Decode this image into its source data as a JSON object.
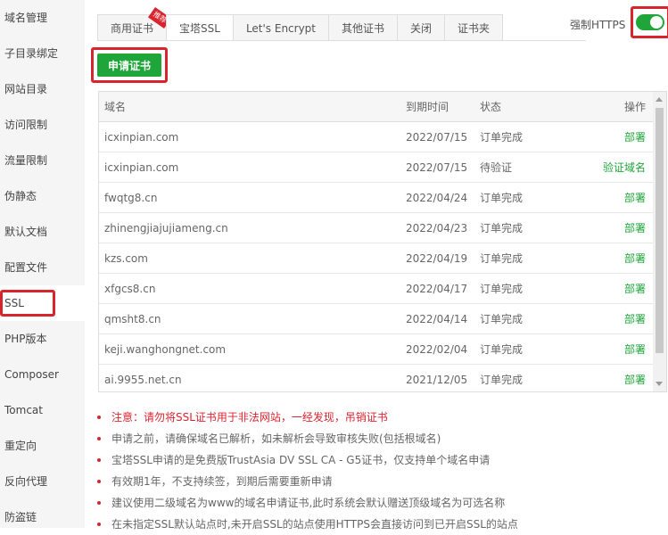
{
  "sidebar": {
    "items": [
      {
        "label": "域名管理"
      },
      {
        "label": "子目录绑定"
      },
      {
        "label": "网站目录"
      },
      {
        "label": "访问限制"
      },
      {
        "label": "流量限制"
      },
      {
        "label": "伪静态"
      },
      {
        "label": "默认文档"
      },
      {
        "label": "配置文件"
      },
      {
        "label": "SSL"
      },
      {
        "label": "PHP版本"
      },
      {
        "label": "Composer"
      },
      {
        "label": "Tomcat"
      },
      {
        "label": "重定向"
      },
      {
        "label": "反向代理"
      },
      {
        "label": "防盗链"
      }
    ]
  },
  "tabs": [
    {
      "label": "商用证书",
      "badge": "推荐"
    },
    {
      "label": "宝塔SSL"
    },
    {
      "label": "Let's Encrypt"
    },
    {
      "label": "其他证书"
    },
    {
      "label": "关闭"
    },
    {
      "label": "证书夹"
    }
  ],
  "https": {
    "label": "强制HTTPS",
    "enabled": true
  },
  "apply_button": "申请证书",
  "table": {
    "headers": {
      "domain": "域名",
      "expiry": "到期时间",
      "status": "状态",
      "action": "操作"
    },
    "rows": [
      {
        "domain": "icxinpian.com",
        "expiry": "2022/07/15",
        "status": "订单完成",
        "action": "部署"
      },
      {
        "domain": "icxinpian.com",
        "expiry": "2022/07/15",
        "status": "待验证",
        "action": "验证域名"
      },
      {
        "domain": "fwqtg8.cn",
        "expiry": "2022/04/24",
        "status": "订单完成",
        "action": "部署"
      },
      {
        "domain": "zhinengjiajujiameng.cn",
        "expiry": "2022/04/23",
        "status": "订单完成",
        "action": "部署"
      },
      {
        "domain": "kzs.com",
        "expiry": "2022/04/19",
        "status": "订单完成",
        "action": "部署"
      },
      {
        "domain": "xfgcs8.cn",
        "expiry": "2022/04/17",
        "status": "订单完成",
        "action": "部署"
      },
      {
        "domain": "qmsht8.cn",
        "expiry": "2022/04/14",
        "status": "订单完成",
        "action": "部署"
      },
      {
        "domain": "keji.wanghongnet.com",
        "expiry": "2022/02/04",
        "status": "订单完成",
        "action": "部署"
      },
      {
        "domain": "ai.9955.net.cn",
        "expiry": "2021/12/05",
        "status": "订单完成",
        "action": "部署"
      }
    ]
  },
  "notes": [
    "注意：请勿将SSL证书用于非法网站，一经发现，吊销证书",
    "申请之前，请确保域名已解析，如未解析会导致审核失败(包括根域名)",
    "宝塔SSL申请的是免费版TrustAsia DV SSL CA - G5证书，仅支持单个域名申请",
    "有效期1年，不支持续签，到期后需要重新申请",
    "建议使用二级域名为www的域名申请证书,此时系统会默认赠送顶级域名为可选名称",
    "在未指定SSL默认站点时,未开启SSL的站点使用HTTPS会直接访问到已开启SSL的站点"
  ],
  "colors": {
    "accent": "#20a53a",
    "highlight": "#d9242e"
  }
}
